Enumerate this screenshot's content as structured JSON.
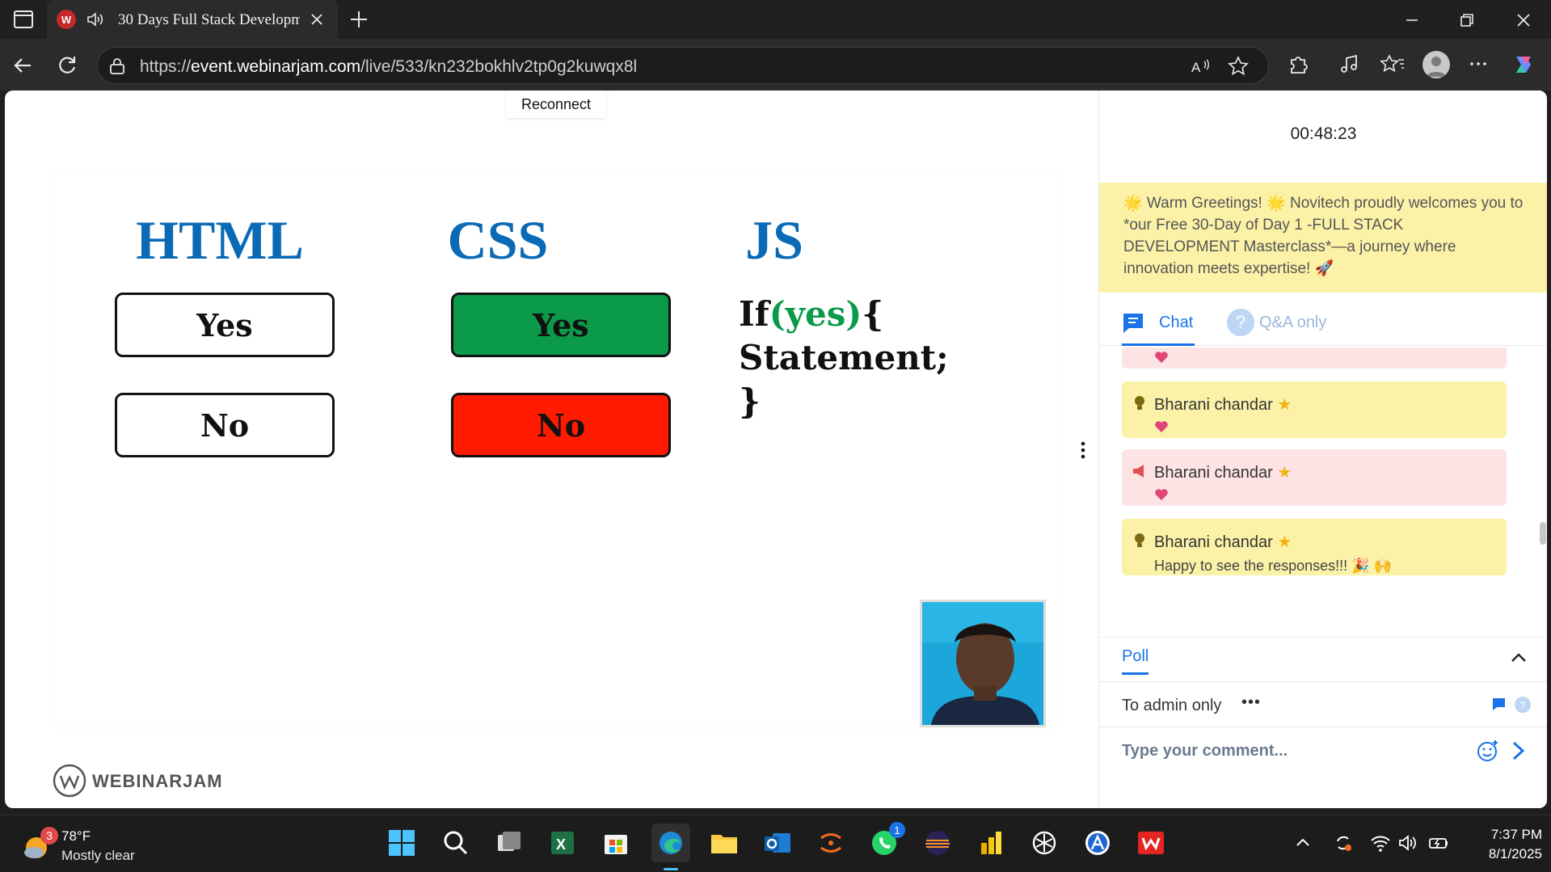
{
  "browser": {
    "tab_title": "30 Days Full Stack Developm",
    "url_prefix": "https://",
    "url_domain": "event.webinarjam.com",
    "url_path": "/live/533/kn232bokhlv2tp0g2kuwqx8l"
  },
  "page": {
    "reconnect_label": "Reconnect"
  },
  "slide": {
    "html_heading": "HTML",
    "css_heading": "CSS",
    "js_heading": "JS",
    "html_yes": "Yes",
    "html_no": "No",
    "css_yes": "Yes",
    "css_no": "No",
    "js_line1_pre": "If",
    "js_line1_kw": "(yes)",
    "js_line1_post": "{",
    "js_line2": "Statement;",
    "js_line3": "}"
  },
  "brand": {
    "logo_text": "WEBINARJAM"
  },
  "panel": {
    "timer": "00:48:23",
    "banner": "🌟 Warm Greetings! 🌟 Novitech proudly welcomes you to *our Free 30-Day of Day 1 -FULL STACK DEVELOPMENT Masterclass*—a journey where innovation meets expertise! 🚀",
    "tab_chat": "Chat",
    "tab_qa": "Q&A only",
    "messages": [
      {
        "name": "Bharani chandar",
        "body": ""
      },
      {
        "name": "Bharani chandar",
        "body": ""
      },
      {
        "name": "Bharani chandar",
        "body": "Happy to see the responses!!! 🎉 🙌"
      }
    ],
    "poll_label": "Poll",
    "admin_label": "To admin only",
    "admin_dots": "•••",
    "comment_placeholder": "Type your comment..."
  },
  "colors": {
    "accent": "#1a73e8",
    "slide_blue": "#0a6ab5",
    "yes_green": "#0a9a4a",
    "no_red": "#ff1a00",
    "banner_yellow": "#fbf2a8",
    "msg_pink": "#fde3e3"
  },
  "taskbar": {
    "weather_temp": "78°F",
    "weather_cond": "Mostly clear",
    "weather_badge": "3",
    "whatsapp_badge": "1",
    "time": "7:37 PM",
    "date": "8/1/2025"
  }
}
